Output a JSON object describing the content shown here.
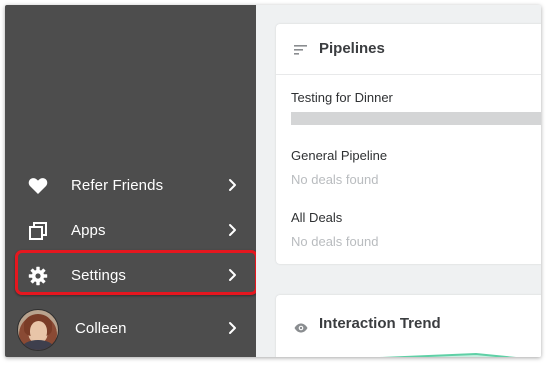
{
  "sidebar": {
    "items": [
      {
        "id": "refer",
        "label": "Refer Friends",
        "icon": "heart-icon"
      },
      {
        "id": "apps",
        "label": "Apps",
        "icon": "apps-icon"
      },
      {
        "id": "settings",
        "label": "Settings",
        "icon": "gear-icon",
        "highlighted": true
      },
      {
        "id": "user",
        "label": "Colleen",
        "icon": "avatar"
      }
    ]
  },
  "pipelines": {
    "title": "Pipelines",
    "icon": "sort-lines-icon",
    "items": [
      {
        "name": "Testing for Dinner",
        "status": "",
        "progress": 1.0
      },
      {
        "name": "General Pipeline",
        "status": "No deals found"
      },
      {
        "name": "All Deals",
        "status": "No deals found"
      }
    ]
  },
  "trend": {
    "title": "Interaction Trend",
    "icon": "eye-icon"
  },
  "colors": {
    "sidebar_bg": "#4d4d4d",
    "highlight_border": "#e5171f",
    "trend_line": "#5fd0a6"
  }
}
